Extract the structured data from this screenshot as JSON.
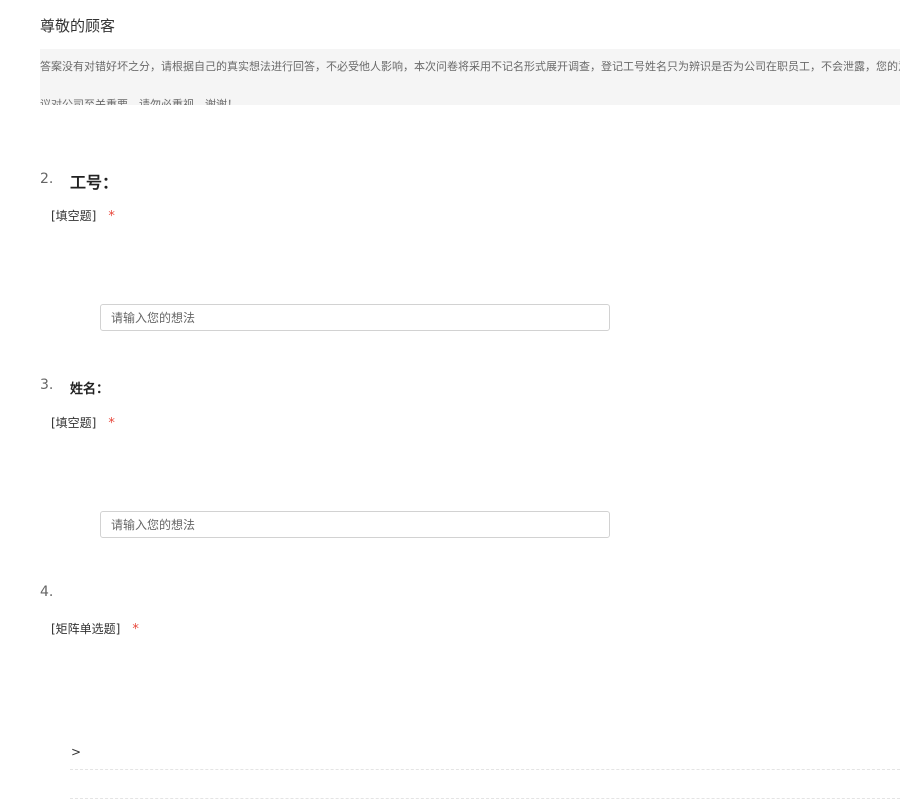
{
  "header": {
    "greeting": "尊敬的顾客",
    "intro": "答案没有对错好坏之分，请根据自己的真实想法进行回答，不必受他人影响，本次问卷将采用不记名形式展开调查，登记工号姓名只为辨识是否为公司在职员工，不会泄露，您的意见和建议对公司至关重要，请勿必重视，谢谢！"
  },
  "questions": [
    {
      "number": "2.",
      "title": "工号：",
      "type": "[填空题]",
      "required_mark": "*",
      "placeholder": "请输入您的想法"
    },
    {
      "number": "3.",
      "title": "姓名：",
      "type": "[填空题]",
      "required_mark": "*",
      "placeholder": "请输入您的想法"
    },
    {
      "number": "4.",
      "title": "",
      "type": "[矩阵单选题]",
      "required_mark": "*",
      "row_label": ">"
    }
  ],
  "colors": {
    "required": "#e8463a",
    "intro_background": "#f5f5f5",
    "input_border": "#d2d2d2"
  }
}
